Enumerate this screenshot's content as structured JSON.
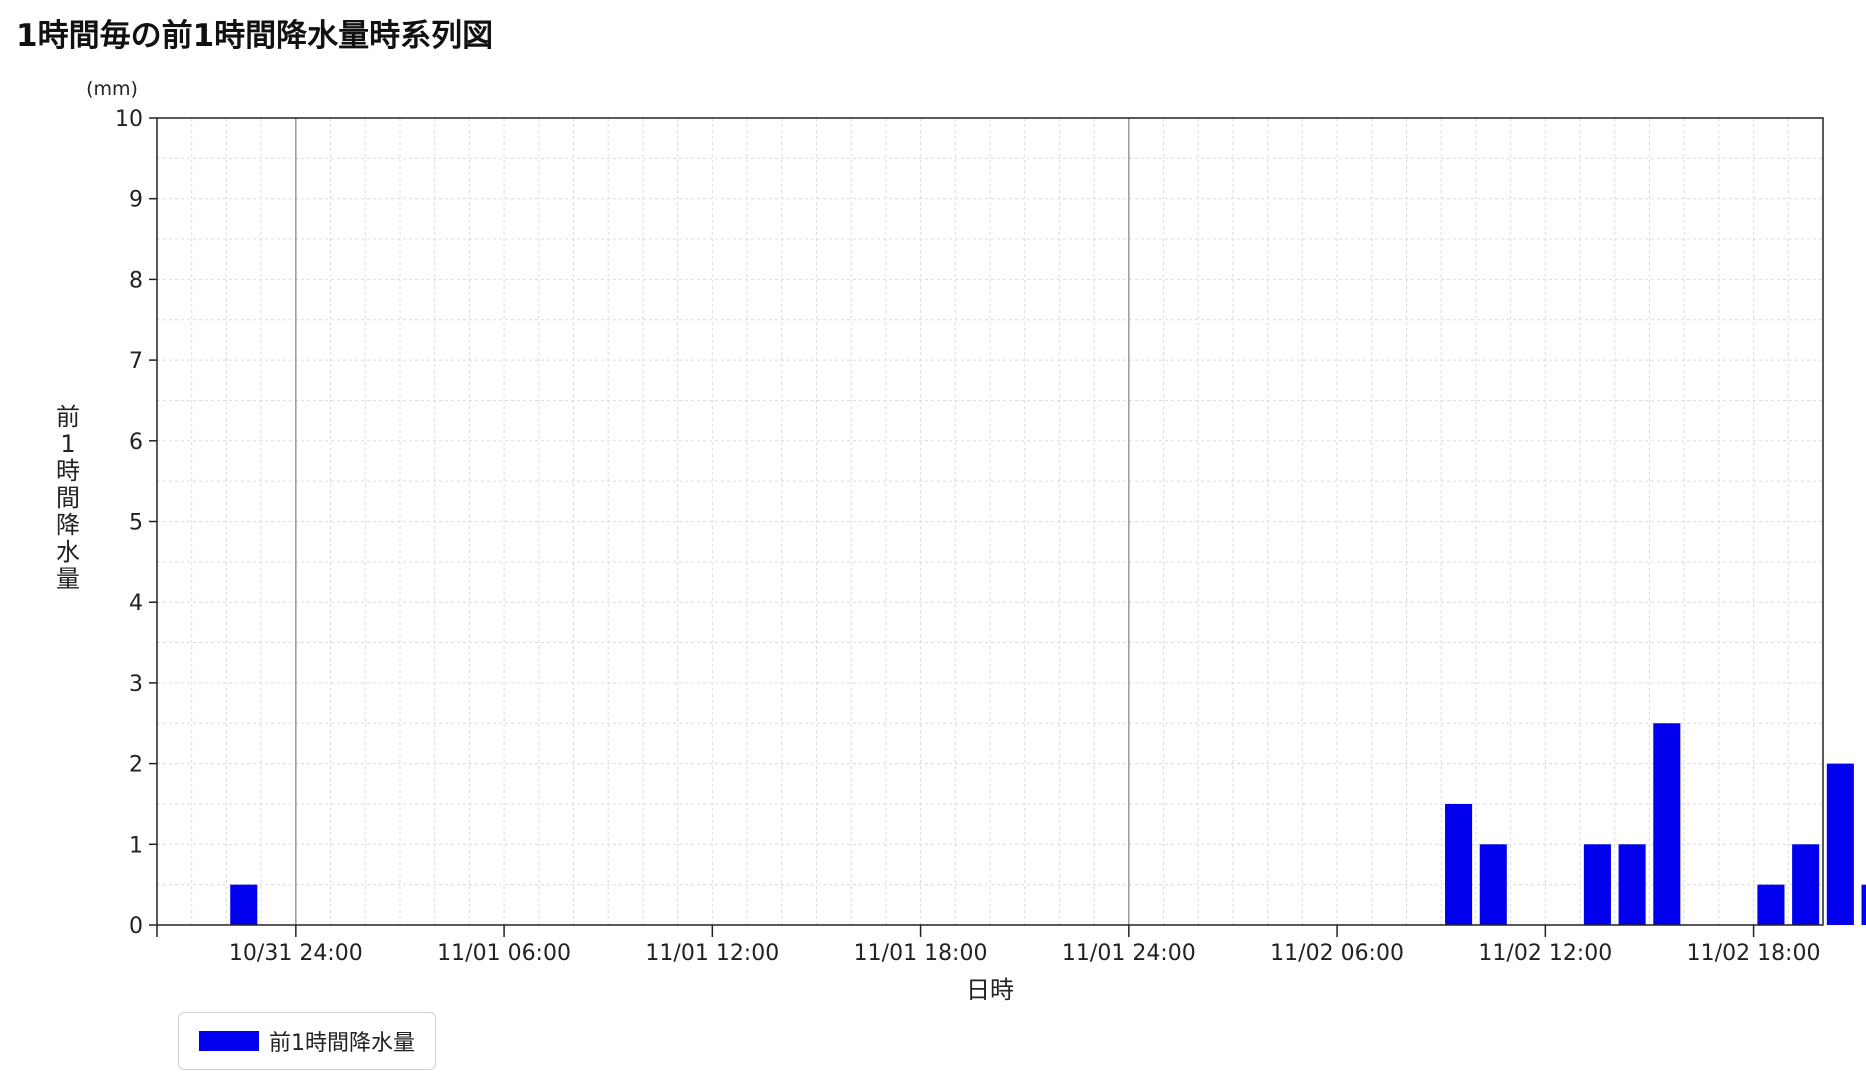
{
  "title": "1時間毎の前1時間降水量時系列図",
  "chart_data": {
    "type": "bar",
    "ylabel": "前1時間降水量",
    "y_unit": "(mm)",
    "xlabel": "日時",
    "ylim": [
      0,
      10
    ],
    "y_ticks": [
      0,
      1,
      2,
      3,
      4,
      5,
      6,
      7,
      8,
      9,
      10
    ],
    "grid": true,
    "legend_position": "bottom-left",
    "x_start": "10/31 20:00",
    "x_end": "11/02 18:00",
    "x_tick_labels": [
      {
        "hour": 4,
        "label": "10/31 24:00"
      },
      {
        "hour": 10,
        "label": "11/01 06:00"
      },
      {
        "hour": 16,
        "label": "11/01 12:00"
      },
      {
        "hour": 22,
        "label": "11/01 18:00"
      },
      {
        "hour": 28,
        "label": "11/01 24:00"
      },
      {
        "hour": 34,
        "label": "11/02 06:00"
      },
      {
        "hour": 40,
        "label": "11/02 12:00"
      },
      {
        "hour": 46,
        "label": "11/02 18:00"
      }
    ],
    "major_lines_hours": [
      4,
      28
    ],
    "series": [
      {
        "name": "前1時間降水量",
        "color": "#0000ee",
        "points": [
          {
            "hour": 3,
            "value": 0.5
          },
          {
            "hour": 38,
            "value": 1.5
          },
          {
            "hour": 39,
            "value": 1.0
          },
          {
            "hour": 42,
            "value": 1.0
          },
          {
            "hour": 43,
            "value": 1.0
          },
          {
            "hour": 44,
            "value": 2.5
          },
          {
            "hour": 47,
            "value": 0.5
          },
          {
            "hour": 48,
            "value": 1.0
          },
          {
            "hour": 49,
            "value": 2.0
          },
          {
            "hour": 50,
            "value": 0.5
          }
        ]
      }
    ]
  }
}
